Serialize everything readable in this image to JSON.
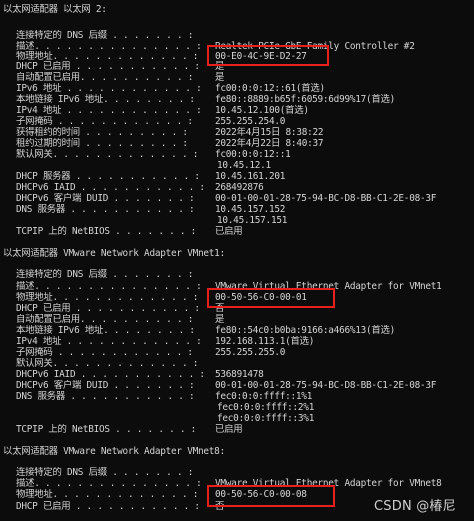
{
  "adapter_ethernet2": {
    "header": "以太网适配器 以太网 2:",
    "lines": [
      {
        "label": "连接特定的 DNS 后缀 . . . . . . . :",
        "value": ""
      },
      {
        "label": "描述. . . . . . . . . . . . . . . :",
        "value": "Realtek PCIe GbE Family Controller #2"
      },
      {
        "label": "物理地址. . . . . . . . . . . . . :",
        "value": "00-E0-4C-9E-D2-27"
      },
      {
        "label": "DHCP 已启用 . . . . . . . . . . . :",
        "value": "是"
      },
      {
        "label": "自动配置已启用. . . . . . . . . . :",
        "value": "是"
      },
      {
        "label": "IPv6 地址 . . . . . . . . . . . . :",
        "value": "fc00:0:0:12::61(首选)"
      },
      {
        "label": "本地链接 IPv6 地址. . . . . . . . :",
        "value": "fe80::8889:b65f:6059:6d99%17(首选)"
      },
      {
        "label": "IPv4 地址 . . . . . . . . . . . . :",
        "value": "10.45.12.100(首选)"
      },
      {
        "label": "子网掩码 . . . . . . . . . . . . :",
        "value": "255.255.254.0"
      },
      {
        "label": "获得租约的时间 . . . . . . . . . :",
        "value": "2022年4月15日 8:38:22"
      },
      {
        "label": "租约过期的时间 . . . . . . . . . :",
        "value": "2022年4月22日 8:40:37"
      },
      {
        "label": "默认网关. . . . . . . . . . . . . :",
        "value": "fc00:0:0:12::1"
      },
      {
        "label": "",
        "value": "10.45.12.1"
      },
      {
        "label": "DHCP 服务器 . . . . . . . . . . . :",
        "value": "10.45.161.201"
      },
      {
        "label": "DHCPv6 IAID . . . . . . . . . . . :",
        "value": "268492876"
      },
      {
        "label": "DHCPv6 客户端 DUID . . . . . . . :",
        "value": "00-01-00-01-28-75-94-BC-D8-BB-C1-2E-08-3F"
      },
      {
        "label": "DNS 服务器 . . . . . . . . . . . :",
        "value": "10.45.157.152"
      },
      {
        "label": "",
        "value": "10.45.157.151"
      },
      {
        "label": "TCPIP 上的 NetBIOS . . . . . . . :",
        "value": "已启用"
      }
    ]
  },
  "adapter_vmnet1": {
    "header": "以太网适配器 VMware Network Adapter VMnet1:",
    "lines": [
      {
        "label": "连接特定的 DNS 后缀 . . . . . . . :",
        "value": ""
      },
      {
        "label": "描述. . . . . . . . . . . . . . . :",
        "value": "VMware Virtual Ethernet Adapter for VMnet1"
      },
      {
        "label": "物理地址. . . . . . . . . . . . . :",
        "value": "00-50-56-C0-00-01"
      },
      {
        "label": "DHCP 已启用 . . . . . . . . . . . :",
        "value": "否"
      },
      {
        "label": "自动配置已启用. . . . . . . . . . :",
        "value": "是"
      },
      {
        "label": "本地链接 IPv6 地址. . . . . . . . :",
        "value": "fe80::54c0:b0ba:9166:a466%13(首选)"
      },
      {
        "label": "IPv4 地址 . . . . . . . . . . . . :",
        "value": "192.168.113.1(首选)"
      },
      {
        "label": "子网掩码 . . . . . . . . . . . . :",
        "value": "255.255.255.0"
      },
      {
        "label": "默认网关. . . . . . . . . . . . . :",
        "value": ""
      },
      {
        "label": "DHCPv6 IAID . . . . . . . . . . . :",
        "value": "536891478"
      },
      {
        "label": "DHCPv6 客户端 DUID . . . . . . . :",
        "value": "00-01-00-01-28-75-94-BC-D8-BB-C1-2E-08-3F"
      },
      {
        "label": "DNS 服务器 . . . . . . . . . . . :",
        "value": "fec0:0:0:ffff::1%1"
      },
      {
        "label": "",
        "value": "fec0:0:0:ffff::2%1"
      },
      {
        "label": "",
        "value": "fec0:0:0:ffff::3%1"
      },
      {
        "label": "TCPIP 上的 NetBIOS . . . . . . . :",
        "value": "已启用"
      }
    ]
  },
  "adapter_vmnet8": {
    "header": "以太网适配器 VMware Network Adapter VMnet8:",
    "lines": [
      {
        "label": "连接特定的 DNS 后缀 . . . . . . . :",
        "value": ""
      },
      {
        "label": "描述. . . . . . . . . . . . . . . :",
        "value": "VMware Virtual Ethernet Adapter for VMnet8"
      },
      {
        "label": "物理地址. . . . . . . . . . . . . :",
        "value": "00-50-56-C0-00-08"
      },
      {
        "label": "DHCP 已启用 . . . . . . . . . . . :",
        "value": "否"
      }
    ]
  },
  "watermark": "CSDN @椿尼",
  "highlight_color": "#e8201c"
}
